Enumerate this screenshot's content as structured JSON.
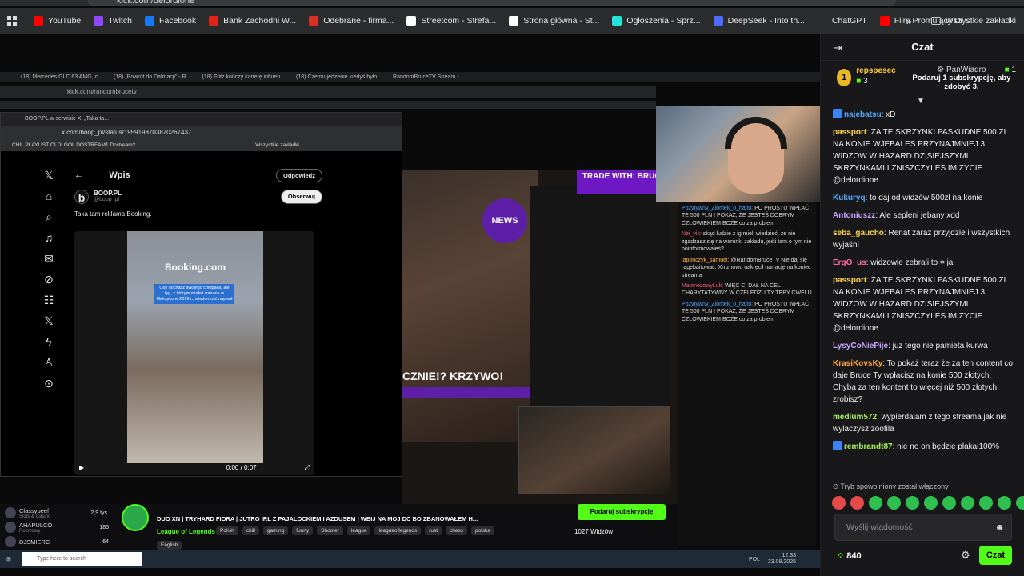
{
  "browser": {
    "url": "kick.com/delordione",
    "bookmarks": [
      {
        "label": "YouTube",
        "color": "#ff0000"
      },
      {
        "label": "Twitch",
        "color": "#9146ff"
      },
      {
        "label": "Facebook",
        "color": "#1877f2"
      },
      {
        "label": "Bank Zachodni W...",
        "color": "#e2231a"
      },
      {
        "label": "Odebrane - firma...",
        "color": "#d93025"
      },
      {
        "label": "Streetcom - Strefa...",
        "color": "#ffffff"
      },
      {
        "label": "Strona główna - St...",
        "color": "#ffffff"
      },
      {
        "label": "Ogłoszenia - Sprz...",
        "color": "#23e5db"
      },
      {
        "label": "DeepSeek - Into th...",
        "color": "#4d6bfe"
      },
      {
        "label": "ChatGPT",
        "color": "#2b2c2e"
      },
      {
        "label": "Film Promujący Dr...",
        "color": "#ff0000"
      }
    ],
    "all_bookmarks": "Wszystkie zakładki"
  },
  "inner": {
    "tabs": [
      "(18) Mercedes GLC 63 AMG, c...",
      "(18) „Powrót do Dalmacji\" - R...",
      "(18) Fritz kończy karierę influen...",
      "(18) Czemu jedzenie kiedyś było...",
      "RandomBruceTV Stream - ..."
    ],
    "address": "kick.com/randombrucetv"
  },
  "xwin": {
    "tab": "BOOP.PL w serwisie X: „Taka ta...",
    "address": "x.com/boop_pl/status/1959198703870267437",
    "bookmarks": "CHIL PLAYLIST   OLDI   GOL   DOSTREAM1   Dostream2",
    "all_bookmarks": "Wszystkie zakładki",
    "header": "Wpis",
    "reply_btn": "Odpowiedz",
    "follow_btn": "Obserwuj",
    "author": "BOOP.PL",
    "handle": "@boop_pl",
    "text": "Taka tam reklama Booking.",
    "video_logo": "Booking.com",
    "video_caption": "Gdy kochasz swojego chłopaka, ale typ, z którym miałaś romans w Maksyku w 2019 r., wiadomość napisał",
    "time": "0:00 / 0:07"
  },
  "stream_view": {
    "news": "NEWS",
    "trade": "TRADE WITH: BRUCE",
    "caption": "CZNIE!? KRZYWO!"
  },
  "mini_chat": [
    {
      "user": "Pozytywny_Ziomek_0_hajtu:",
      "text": "PO PROSTU WPŁAĆ TE 500 PLN I POKAŻ, ŻE JESTEŚ DOBRYM CZŁOWIEKIEM BOŻE co za problem",
      "cls": "u1"
    },
    {
      "user": "Nei_vik:",
      "text": "skąd ludzie z ig mieli wiedzieć, że nie zgadzasz się na warunki zakładu, jeśli tam o tym nie poinformowałeś?",
      "cls": "u2"
    },
    {
      "user": "japonczyk_samuel:",
      "text": "@RandomBruceTV Nie daj się ragebaitować. Xn znowu nakręcił narrację na koniec streama",
      "cls": "u3"
    },
    {
      "user": "MajonezowyLuk:",
      "text": "WIĘC CI DAŁ NA CEL CHARYTATYWNY W CZELEDZU TY TĘPY CWELU",
      "cls": "u2"
    },
    {
      "user": "Pozytywny_Ziomek_0_hajtu:",
      "text": "PO PROSTU WPŁAĆ TE 500 PLN I POKAŻ, ŻE JESTEŚ DOBRYM CZŁOWIEKIEM BOŻE co za problem",
      "cls": "u1"
    }
  ],
  "stream_bar": {
    "side": [
      {
        "name": "Classybeef",
        "sub": "Slots & Casino",
        "count": "2,9 tys."
      },
      {
        "name": "AHAPULCO",
        "sub": "Rozmowy",
        "count": "185"
      },
      {
        "name": "DJSMIERC",
        "sub": "",
        "count": "64"
      }
    ],
    "title": "DUO XN | TRYHARD FIORA | JUTRO IRL Z PAJALOCKIEM I AZDUSEM | WBIJ NA MOJ DC BO ZBANOWAŁEM H...",
    "category": "League of Legends",
    "tags": [
      "Polish",
      "chill",
      "gaming",
      "funny",
      "Shooter",
      "league",
      "leagueoflegends",
      "rust",
      "chess",
      "polska"
    ],
    "lang": "English",
    "subscribe": "Podaruj subskrypcję",
    "viewers": "1027 Widzów"
  },
  "taskbar": {
    "search": "Type here to search",
    "lang": "POL",
    "time": "12:33",
    "date": "23.08.2025"
  },
  "chat": {
    "title": "Czat",
    "pinned": {
      "rank": "1",
      "user": "repspesec",
      "user_count": "3",
      "gifter": "PanWiadro",
      "gift_count": "1",
      "gift_text": "Podaruj 1 subskrypcję, aby zdobyć 3."
    },
    "messages": [
      {
        "user": "najebatsu",
        "text": "xD",
        "color": "c-blue",
        "badge": "#3b82f6"
      },
      {
        "user": "passport",
        "text": "ZA TE SKRZYNKI PASKUDNE 500 ZL NA KONIE WJEBALES PRZYNAJMNIEJ 3 WIDZOW W HAZARD DZISIEJSZYMI SKRZYNKAMI I ZNISZCZYLES IM ZYCIE @delordione",
        "color": "c-yellow",
        "badge": ""
      },
      {
        "user": "Kukuryq",
        "text": "to daj od widzów 500zł na konie",
        "color": "c-blue",
        "badge": ""
      },
      {
        "user": "Antoniuszz",
        "text": "Ale sepleni jebany xdd",
        "color": "c-purple",
        "badge": ""
      },
      {
        "user": "seba_gaucho",
        "text": "Renat zaraz przyjdzie i wszystkich wyjaśni",
        "color": "c-yellow",
        "badge": ""
      },
      {
        "user": "ErgO_us",
        "text": "widzowie zebrali to = ja",
        "color": "c-pink",
        "badge": ""
      },
      {
        "user": "passport",
        "text": "ZA TE SKRZYNKI PASKUDNE 500 ZL NA KONIE WJEBALES PRZYNAJMNIEJ 3 WIDZOW W HAZARD DZISIEJSZYMI SKRZYNKAMI I ZNISZCZYLES IM ZYCIE @delordione",
        "color": "c-yellow",
        "badge": ""
      },
      {
        "user": "LysyCoNiePije",
        "text": "juz tego nie pamieta kurwa",
        "color": "c-purple",
        "badge": ""
      },
      {
        "user": "KrasiKovsKy",
        "text": "To pokaż teraz że za ten content co daje Bruce Ty wpłacisz na konie 500 złotych. Chyba za ten kontent to więcej niż 500 złotych zrobisz?",
        "color": "c-orange",
        "badge": ""
      },
      {
        "user": "medium572",
        "text": "wypierdalam z tego streama jak nie wylaczysz zoofila",
        "color": "c-lime",
        "badge": ""
      },
      {
        "user": "rembrandt87",
        "text": "nie no on będzie płakał100%",
        "color": "c-lime",
        "badge": "#3b82f6"
      }
    ],
    "slowmode": "Tryb spowolniony został włączony",
    "input_placeholder": "Wyślij wiadomość",
    "points": "840",
    "send": "Czat"
  }
}
